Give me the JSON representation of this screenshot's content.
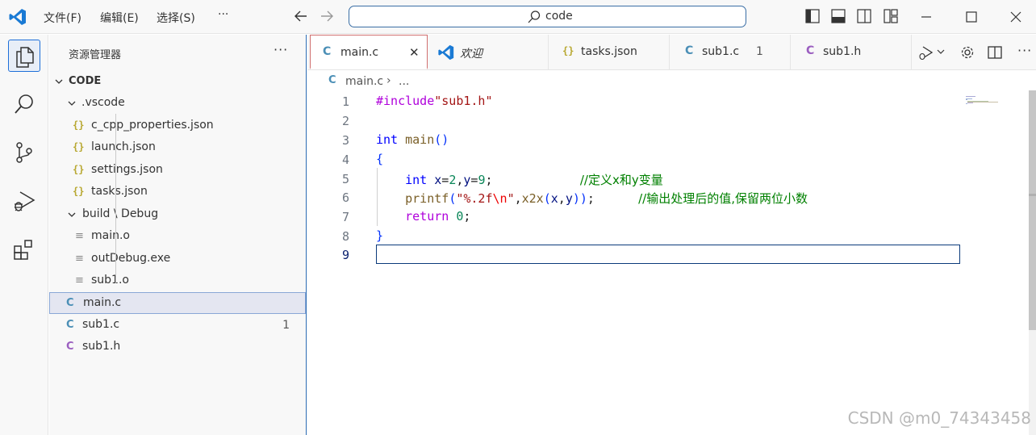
{
  "titlebar": {
    "menus": [
      "文件(F)",
      "编辑(E)",
      "选择(S)",
      "···"
    ],
    "search_text": "code"
  },
  "sidebar": {
    "title": "资源管理器",
    "more": "···",
    "root": "CODE",
    "items": [
      {
        "label": ".vscode",
        "type": "folder",
        "icon": "chevron-down-icon"
      },
      {
        "label": "c_cpp_properties.json",
        "type": "json",
        "icon": "{}"
      },
      {
        "label": "launch.json",
        "type": "json",
        "icon": "{}"
      },
      {
        "label": "settings.json",
        "type": "json",
        "icon": "{}"
      },
      {
        "label": "tasks.json",
        "type": "json",
        "icon": "{}"
      },
      {
        "label": "build \\ Debug",
        "type": "folder",
        "icon": "chevron-down-icon"
      },
      {
        "label": "main.o",
        "type": "file",
        "icon": "≡"
      },
      {
        "label": "outDebug.exe",
        "type": "file",
        "icon": "≡"
      },
      {
        "label": "sub1.o",
        "type": "file",
        "icon": "≡"
      },
      {
        "label": "main.c",
        "type": "c",
        "icon": "C"
      },
      {
        "label": "sub1.c",
        "type": "c",
        "icon": "C",
        "badge": "1"
      },
      {
        "label": "sub1.h",
        "type": "h",
        "icon": "C"
      }
    ]
  },
  "tabs": [
    {
      "label": "main.c",
      "icon": "C",
      "close": "✕"
    },
    {
      "label": "欢迎",
      "icon": "vscode-logo"
    },
    {
      "label": "tasks.json",
      "icon": "{}"
    },
    {
      "label": "sub1.c",
      "icon": "C",
      "badge": "1"
    },
    {
      "label": "sub1.h",
      "icon": "C"
    }
  ],
  "breadcrumb": {
    "icon": "C",
    "file": "main.c",
    "sep": "›",
    "rest": "..."
  },
  "editor": {
    "line_numbers": [
      "1",
      "2",
      "3",
      "4",
      "5",
      "6",
      "7",
      "8",
      "9"
    ],
    "comment1": "//定义x和y变量",
    "comment2": "//输出处理后的值,保留两位小数"
  },
  "watermark": "CSDN @m0_74343458"
}
